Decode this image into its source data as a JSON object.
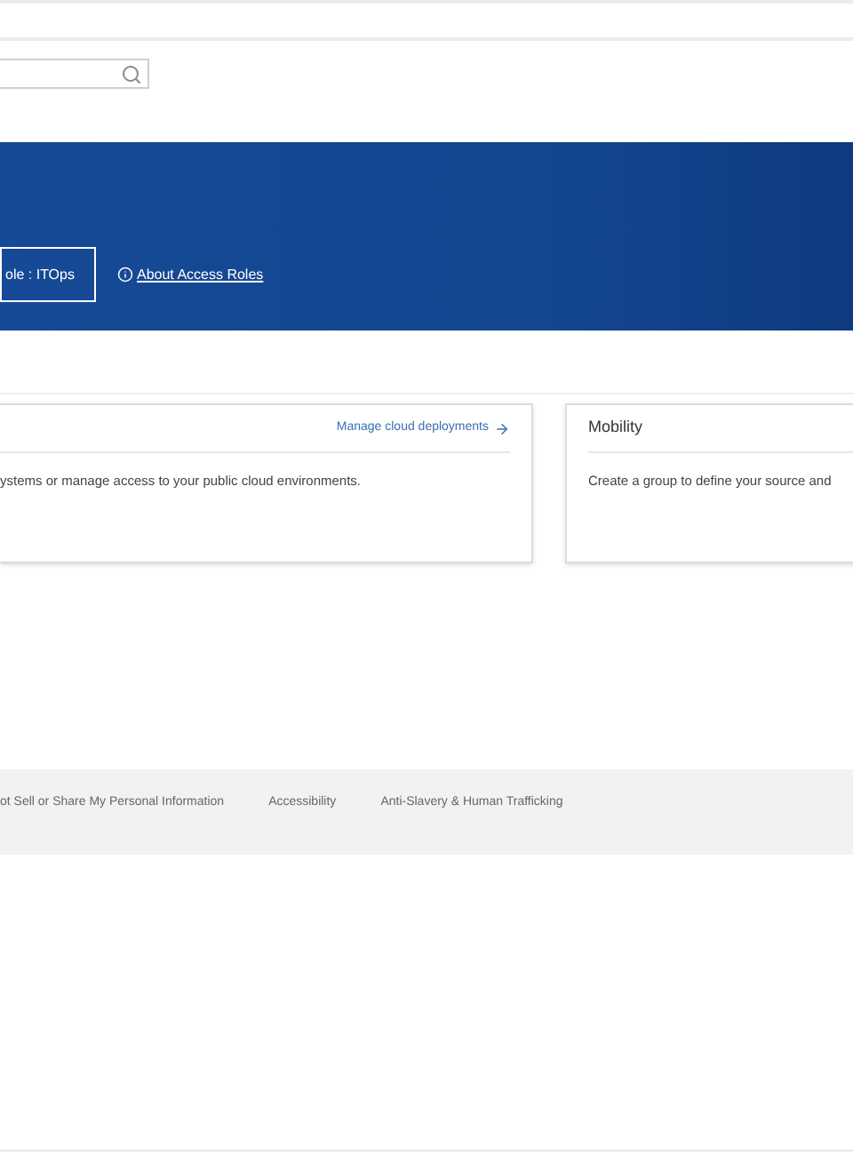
{
  "banner": {
    "role": "ole :  ITOps",
    "about_link": "About Access Roles"
  },
  "cards": [
    {
      "link": "Manage cloud deployments",
      "description": "ystems or manage access to your public cloud environments."
    },
    {
      "title": "Mobility",
      "description": "Create a group to define your source and"
    }
  ],
  "footer": {
    "links": [
      "ot Sell or Share My Personal Information",
      "Accessibility",
      "Anti-Slavery & Human Trafficking"
    ]
  }
}
